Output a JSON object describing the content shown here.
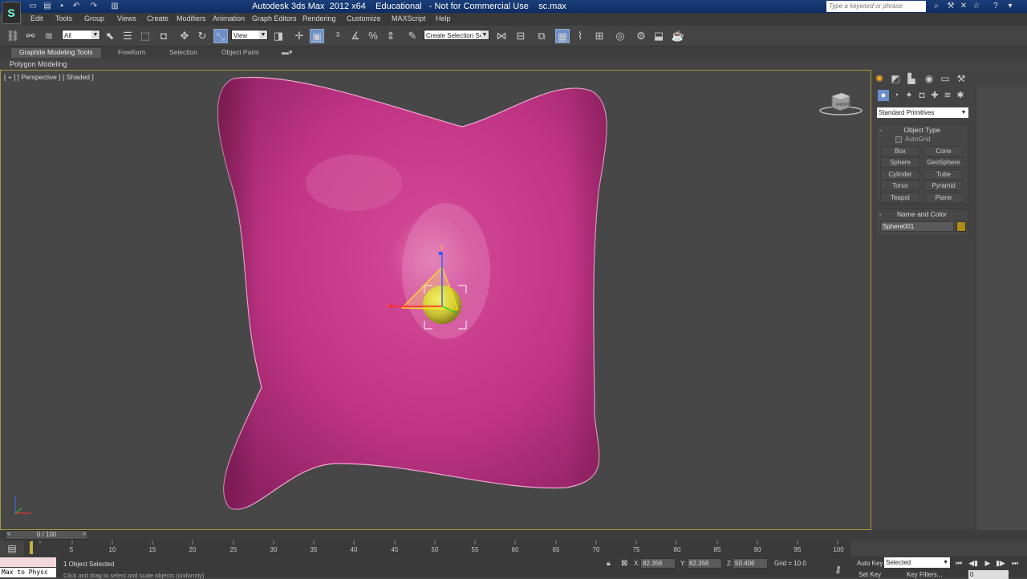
{
  "app": {
    "title": "Autodesk 3ds Max  2012 x64    Educational   - Not for Commercial Use    sc.max",
    "logo": "3ds-max-logo",
    "search_placeholder": "Type a keyword or phrase"
  },
  "menubar": {
    "items": [
      "Edit",
      "Tools",
      "Group",
      "Views",
      "Create",
      "Modifiers",
      "Animation",
      "Graph Editors",
      "Rendering",
      "Customize",
      "MAXScript",
      "Help"
    ]
  },
  "toolbar": {
    "selection_filter": "All",
    "reference_coord": "View",
    "named_selection": "Create Selection Se"
  },
  "ribbon": {
    "tabs": [
      "Graphite Modeling Tools",
      "Freeform",
      "Selection",
      "Object Paint"
    ],
    "sub_label": "Polygon Modeling"
  },
  "viewport": {
    "label": "[ + ] [ Perspective ] [ Shaded ]",
    "viewcube_label": "FRONT",
    "gizmo_axis_x": "x",
    "gizmo_axis_z": "z",
    "object_color": "#d43a8e",
    "sphere_color": "#c9c032"
  },
  "command_panel": {
    "category": "Standard Primitives",
    "object_type": {
      "title": "Object Type",
      "autogrid": "AutoGrid",
      "buttons": [
        "Box",
        "Cone",
        "Sphere",
        "GeoSphere",
        "Cylinder",
        "Tube",
        "Torus",
        "Pyramid",
        "Teapot",
        "Plane"
      ]
    },
    "name_and_color": {
      "title": "Name and Color",
      "name": "Sphere001",
      "color": "#b08a18"
    }
  },
  "timeline": {
    "slider_label": "0 / 100",
    "ticks": [
      "5",
      "10",
      "15",
      "20",
      "25",
      "30",
      "35",
      "40",
      "45",
      "50",
      "55",
      "60",
      "65",
      "70",
      "75",
      "80",
      "85",
      "90",
      "95",
      "100"
    ]
  },
  "status": {
    "listener_text": "Max to Physc",
    "selection_status": "1 Object Selected",
    "prompt": "Click and drag to select and scale objects (uniformly)",
    "x_label": "X:",
    "x_value": "82.356",
    "y_label": "Y:",
    "y_value": "82.356",
    "z_label": "Z:",
    "z_value": "50.406",
    "grid": "Grid = 10.0",
    "autokey": "Auto Key",
    "setkey": "Set Key",
    "key_mode": "Selected",
    "key_filters": "Key Filters...",
    "frame": "0"
  }
}
